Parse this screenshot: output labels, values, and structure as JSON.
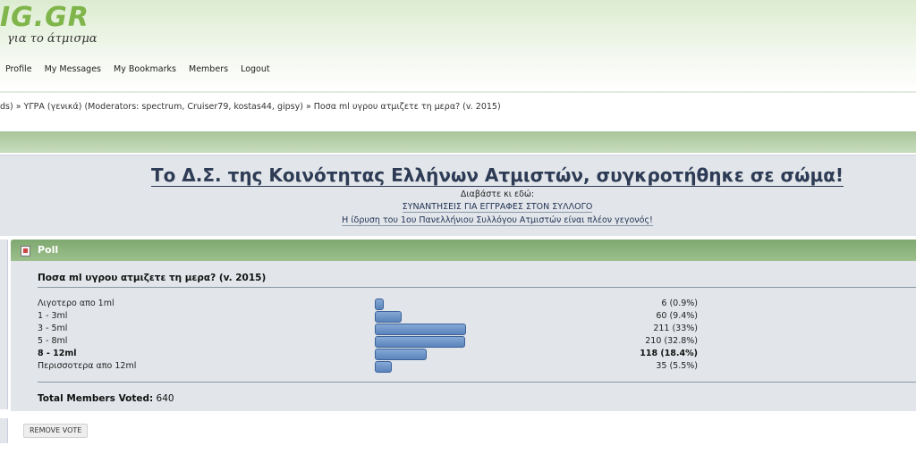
{
  "header": {
    "logo": "IG.GR",
    "tagline": "για το άτμισμα",
    "nav": [
      "Profile",
      "My Messages",
      "My Bookmarks",
      "Members",
      "Logout"
    ]
  },
  "breadcrumb": "ds) » ΥΓΡΑ (γενικά) (Moderators: spectrum, Cruiser79, kostas44, gipsy) » Ποσα ml υγρου ατμιζετε τη μερα? (v. 2015)",
  "announcement": {
    "title": "Το Δ.Σ. της Κοινότητας Ελλήνων Ατμιστών, συγκροτήθηκε σε σώμα!",
    "subtitle": "Διαβάστε κι εδώ:",
    "link1": "ΣΥΝΑΝΤΗΣΕΙΣ ΓΙΑ ΕΓΓΡΑΦΕΣ ΣΤΟΝ ΣΥΛΛΟΓΟ",
    "link2": "Η ίδρυση του 1ου Πανελλήνιου Συλλόγου Ατμιστών είναι πλέον γεγονός!"
  },
  "poll": {
    "header": "Poll",
    "question": "Ποσα ml υγρου ατμιζετε τη μερα? (v. 2015)",
    "options": [
      {
        "label": "Λιγοτερο απο 1ml",
        "result": "6 (0.9%)",
        "percent": 0.9,
        "selected": false
      },
      {
        "label": "1 - 3ml",
        "result": "60 (9.4%)",
        "percent": 9.4,
        "selected": false
      },
      {
        "label": "3 - 5ml",
        "result": "211 (33%)",
        "percent": 33,
        "selected": false
      },
      {
        "label": "5 - 8ml",
        "result": "210 (32.8%)",
        "percent": 32.8,
        "selected": false
      },
      {
        "label": "8 - 12ml",
        "result": "118 (18.4%)",
        "percent": 18.4,
        "selected": true
      },
      {
        "label": "Περισσοτερα απο 12ml",
        "result": "35 (5.5%)",
        "percent": 5.5,
        "selected": false
      }
    ],
    "total_label": "Total Members Voted:",
    "total_value": "640",
    "remove_vote": "REMOVE VOTE"
  },
  "colors": {
    "bar": "#5b84bb",
    "poll_header": "#8ab27c",
    "logo": "#7fb54a"
  }
}
